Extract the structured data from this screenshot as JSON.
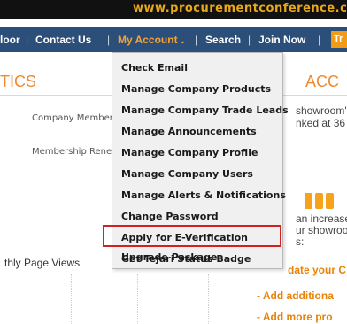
{
  "banner": {
    "url": "www.procurementconference.c"
  },
  "nav": {
    "items": [
      "loor",
      "Contact Us",
      "My Account",
      "Search",
      "Join Now"
    ],
    "tab_label": "Tr"
  },
  "left": {
    "heading": "TICS",
    "company_members": "Company Members",
    "membership_renew": "Membership Renew",
    "monthly_page_views": "thly Page Views"
  },
  "right": {
    "heading": "ACC",
    "line1": "showroom'",
    "line2": "nked at 36",
    "line3": "an increase",
    "line4": "ur showroo",
    "line5": "s:",
    "update_link": "date your C",
    "add_link": "- Add additiona",
    "add_more": "- Add more pro"
  },
  "dropdown": {
    "items": [
      "Check Email",
      "Manage Company Products",
      "Manage Company Trade Leads",
      "Manage Announcements",
      "Manage Company Profile",
      "Manage Company Users",
      "Manage Alerts & Notifications",
      "Change Password",
      "Apply for E-Verification",
      "Get Tejari Status Badge",
      "Upgrade Package"
    ]
  },
  "colors": {
    "nav_bg": "#2c4f79",
    "accent": "#f08a2e",
    "highlight": "#d32020"
  }
}
